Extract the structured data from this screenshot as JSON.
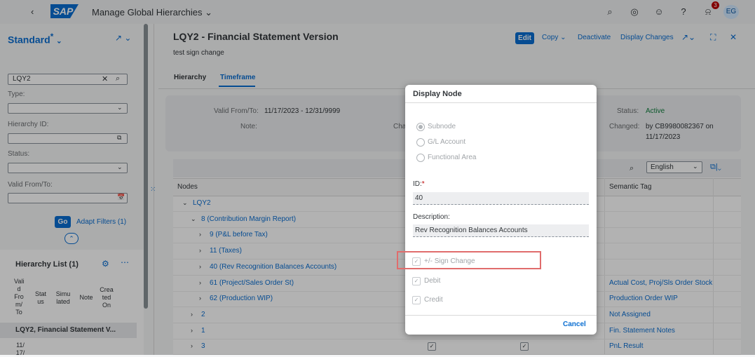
{
  "shell": {
    "logo": "SAP",
    "app_title": "Manage Global Hierarchies ⌄",
    "notification_count": "3",
    "avatar_initials": "EG"
  },
  "left": {
    "variant": "Standard",
    "variant_star": "*",
    "search_value": "LQY2",
    "type_label": "Type:",
    "hierarchy_id_label": "Hierarchy ID:",
    "status_label": "Status:",
    "valid_label": "Valid From/To:",
    "go": "Go",
    "adapt_filters": "Adapt Filters (1)",
    "list_title": "Hierarchy List (1)",
    "columns": [
      "Vali d Fro m/ To",
      "Stat us",
      "Simu lated",
      "Note",
      "Crea ted On"
    ],
    "row_title": "LQY2, Financial Statement V...",
    "row_date": "11/ 17/"
  },
  "header": {
    "title": "LQY2 - Financial Statement Version",
    "subtitle": "test sign change",
    "edit": "Edit",
    "copy": "Copy ⌄",
    "deactivate": "Deactivate",
    "display_changes": "Display Changes"
  },
  "tabs": [
    "Hierarchy",
    "Timeframe"
  ],
  "info": {
    "valid_label": "Valid From/To:",
    "valid_value": "11/17/2023 - 12/31/9999",
    "note_label": "Note:",
    "cha_fragment": "Cha",
    "status_label": "Status:",
    "status_value": "Active",
    "changed_label": "Changed:",
    "changed_value_1": "by CB9980082367 on",
    "changed_value_2": "11/17/2023"
  },
  "table": {
    "language": "English",
    "col_nodes": "Nodes",
    "col_semantic": "Semantic Tag",
    "rows": [
      {
        "label": "LQY2",
        "indent": 0,
        "chev": "⌄",
        "sem": ""
      },
      {
        "label": "8 (Contribution Margin Report)",
        "indent": 1,
        "chev": "⌄",
        "sem": ""
      },
      {
        "label": "9 (P&L before Tax)",
        "indent": 2,
        "chev": "›",
        "sem": ""
      },
      {
        "label": "11 (Taxes)",
        "indent": 2,
        "chev": "›",
        "sem": ""
      },
      {
        "label": "40 (Rev Recognition Balances Accounts)",
        "indent": 2,
        "chev": "›",
        "sem": ""
      },
      {
        "label": "61 (Project/Sales Order St)",
        "indent": 2,
        "chev": "›",
        "sem": "Actual Cost, Proj/Sls Order Stock"
      },
      {
        "label": "62 (Production WIP)",
        "indent": 2,
        "chev": "›",
        "sem": "Production Order WIP"
      },
      {
        "label": "2",
        "indent": 1,
        "chev": "›",
        "sem": "Not Assigned"
      },
      {
        "label": "1",
        "indent": 1,
        "chev": "›",
        "sem": "Fin. Statement Notes"
      },
      {
        "label": "3",
        "indent": 1,
        "chev": "›",
        "sem": "PnL Result"
      }
    ]
  },
  "dialog": {
    "title": "Display Node",
    "radio_subnode": "Subnode",
    "radio_gl": "G/L Account",
    "radio_fa": "Functional Area",
    "id_label": "ID:",
    "id_required": "*",
    "id_value": "40",
    "desc_label": "Description:",
    "desc_value": "Rev Recognition Balances Accounts",
    "sign_change": "+/- Sign Change",
    "debit": "Debit",
    "credit": "Credit",
    "cancel": "Cancel"
  }
}
